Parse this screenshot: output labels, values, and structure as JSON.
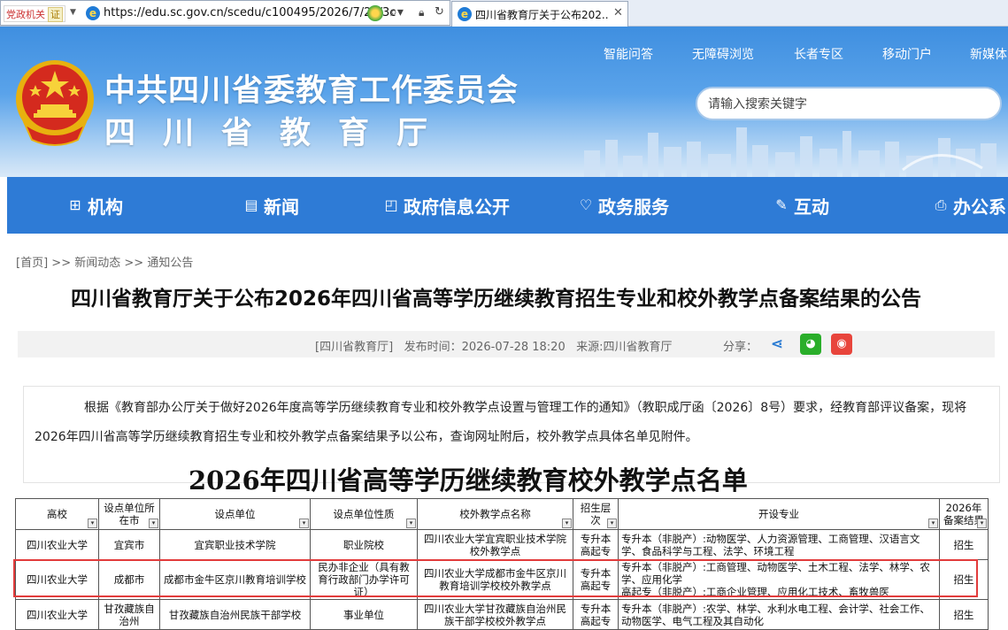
{
  "browser": {
    "badge_text": "党政机关",
    "badge_cert": "证",
    "url": "https://edu.sc.gov.cn/scedu/c100495/2026/7/28/3c",
    "tab_title": "四川省教育厅关于公布202..."
  },
  "site": {
    "org_name": "中共四川省委教育工作委员会",
    "dept_name": "四川省教育厅",
    "top_links": [
      "智能问答",
      "无障碍浏览",
      "长者专区",
      "移动门户",
      "新媒体"
    ],
    "search_placeholder": "请输入搜索关键字"
  },
  "nav": [
    {
      "label": "机构",
      "icon": "org-chart-icon",
      "glyph": "⊞"
    },
    {
      "label": "新闻",
      "icon": "news-icon",
      "glyph": "▤"
    },
    {
      "label": "政府信息公开",
      "icon": "info-disclosure-icon",
      "glyph": "◰"
    },
    {
      "label": "政务服务",
      "icon": "heart-service-icon",
      "glyph": "♡"
    },
    {
      "label": "互动",
      "icon": "interaction-icon",
      "glyph": "✎"
    },
    {
      "label": "办公系",
      "icon": "printer-icon",
      "glyph": "⎙"
    }
  ],
  "breadcrumb": [
    "[首页]",
    ">>",
    "新闻动态",
    ">>",
    "通知公告"
  ],
  "article": {
    "title": "四川省教育厅关于公布2026年四川省高等学历继续教育招生专业和校外教学点备案结果的公告",
    "source_tag": "[四川省教育厅]",
    "publish_time": "发布时间：2026-07-28 18:20",
    "source": "来源:四川省教育厅",
    "share_label": "分享：",
    "paragraph": "根据《教育部办公厅关于做好2026年度高等学历继续教育专业和校外教学点设置与管理工作的通知》（教职成厅函〔2026〕8号）要求，经教育部评议备案，现将2026年四川省高等学历继续教育招生专业和校外教学点备案结果予以公布，查询网址附后，校外教学点具体名单见附件。",
    "doc_heading": "2026年四川省高等学历继续教育校外教学点名单"
  },
  "table": {
    "headers": [
      "高校",
      "设点单位所在市",
      "设点单位",
      "设点单位性质",
      "校外教学点名称",
      "招生层次",
      "开设专业",
      "2026年备案结果"
    ],
    "rows": [
      {
        "university": "四川农业大学",
        "city": "宜宾市",
        "unit": "宜宾职业技术学院",
        "nature": "职业院校",
        "site_name": "四川农业大学宜宾职业技术学院校外教学点",
        "level": "专升本\n高起专",
        "majors": "专升本（非脱产）:动物医学、人力资源管理、工商管理、汉语言文学、食品科学与工程、法学、环境工程",
        "result": "招生"
      },
      {
        "university": "四川农业大学",
        "city": "成都市",
        "unit": "成都市金牛区京川教育培训学校",
        "nature": "民办非企业（具有教育行政部门办学许可证）",
        "site_name": "四川农业大学成都市金牛区京川教育培训学校校外教学点",
        "level": "专升本\n高起专",
        "majors": "专升本（非脱产）:工商管理、动物医学、土木工程、法学、林学、农学、应用化学\n高起专（非脱产）:工商企业管理、应用化工技术、畜牧兽医",
        "result": "招生"
      },
      {
        "university": "四川农业大学",
        "city": "甘孜藏族自治州",
        "unit": "甘孜藏族自治州民族干部学校",
        "nature": "事业单位",
        "site_name": "四川农业大学甘孜藏族自治州民族干部学校校外教学点",
        "level": "专升本\n高起专",
        "majors": "专升本（非脱产）:农学、林学、水利水电工程、会计学、社会工作、动物医学、电气工程及其自动化",
        "result": "招生"
      }
    ]
  },
  "colors": {
    "nav_bg": "#2e7bd6",
    "highlight": "#e23b3b",
    "wechat": "#2aae2a",
    "weibo": "#e8453c"
  }
}
